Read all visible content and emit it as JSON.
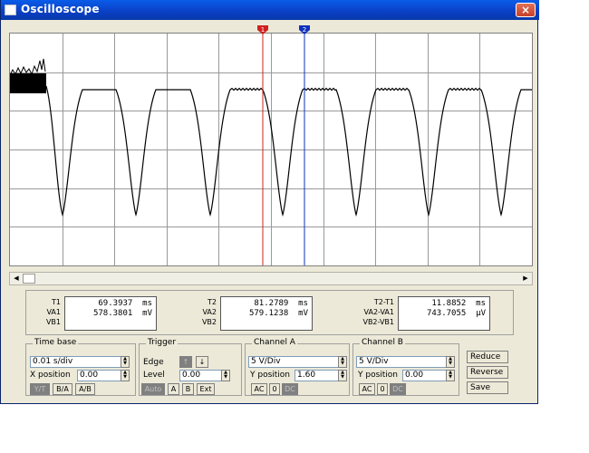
{
  "window": {
    "title": "Oscilloscope",
    "close_glyph": "×"
  },
  "cursors": {
    "t1_label": "1",
    "t2_label": "2",
    "t1_color": "#d02020",
    "t2_color": "#1030c0"
  },
  "colors": {
    "grid": "#999999",
    "trace": "#000000"
  },
  "measurements": {
    "t1": {
      "label": "T1",
      "time": "69.3937  ms",
      "va_label": "VA1",
      "va": "578.3801  mV",
      "vb_label": "VB1",
      "vb": ""
    },
    "t2": {
      "label": "T2",
      "time": "81.2789  ms",
      "va_label": "VA2",
      "va": "579.1238  mV",
      "vb_label": "VB2",
      "vb": ""
    },
    "diff": {
      "label": "T2-T1",
      "time": "11.8852  ms",
      "va_label": "VA2-VA1",
      "va": "743.7055  µV",
      "vb_label": "VB2-VB1",
      "vb": ""
    }
  },
  "timebase": {
    "title": "Time base",
    "value": "0.01 s/div",
    "xpos_label": "X position",
    "xpos": "0.00",
    "modes": [
      "Y/T",
      "B/A",
      "A/B"
    ]
  },
  "trigger": {
    "title": "Trigger",
    "edge_label": "Edge",
    "edge_rising": "↑",
    "edge_falling": "↓",
    "level_label": "Level",
    "level": "0.00",
    "sources": [
      "Auto",
      "A",
      "B",
      "Ext"
    ]
  },
  "channel_a": {
    "title": "Channel A",
    "value": "5 V/Div",
    "ypos_label": "Y position",
    "ypos": "1.60",
    "coupling": [
      "AC",
      "0",
      "DC"
    ]
  },
  "channel_b": {
    "title": "Channel B",
    "value": "5 V/Div",
    "ypos_label": "Y position",
    "ypos": "0.00",
    "coupling": [
      "AC",
      "0",
      "DC"
    ]
  },
  "actions": {
    "reduce": "Reduce",
    "reverse": "Reverse",
    "save": "Save"
  }
}
